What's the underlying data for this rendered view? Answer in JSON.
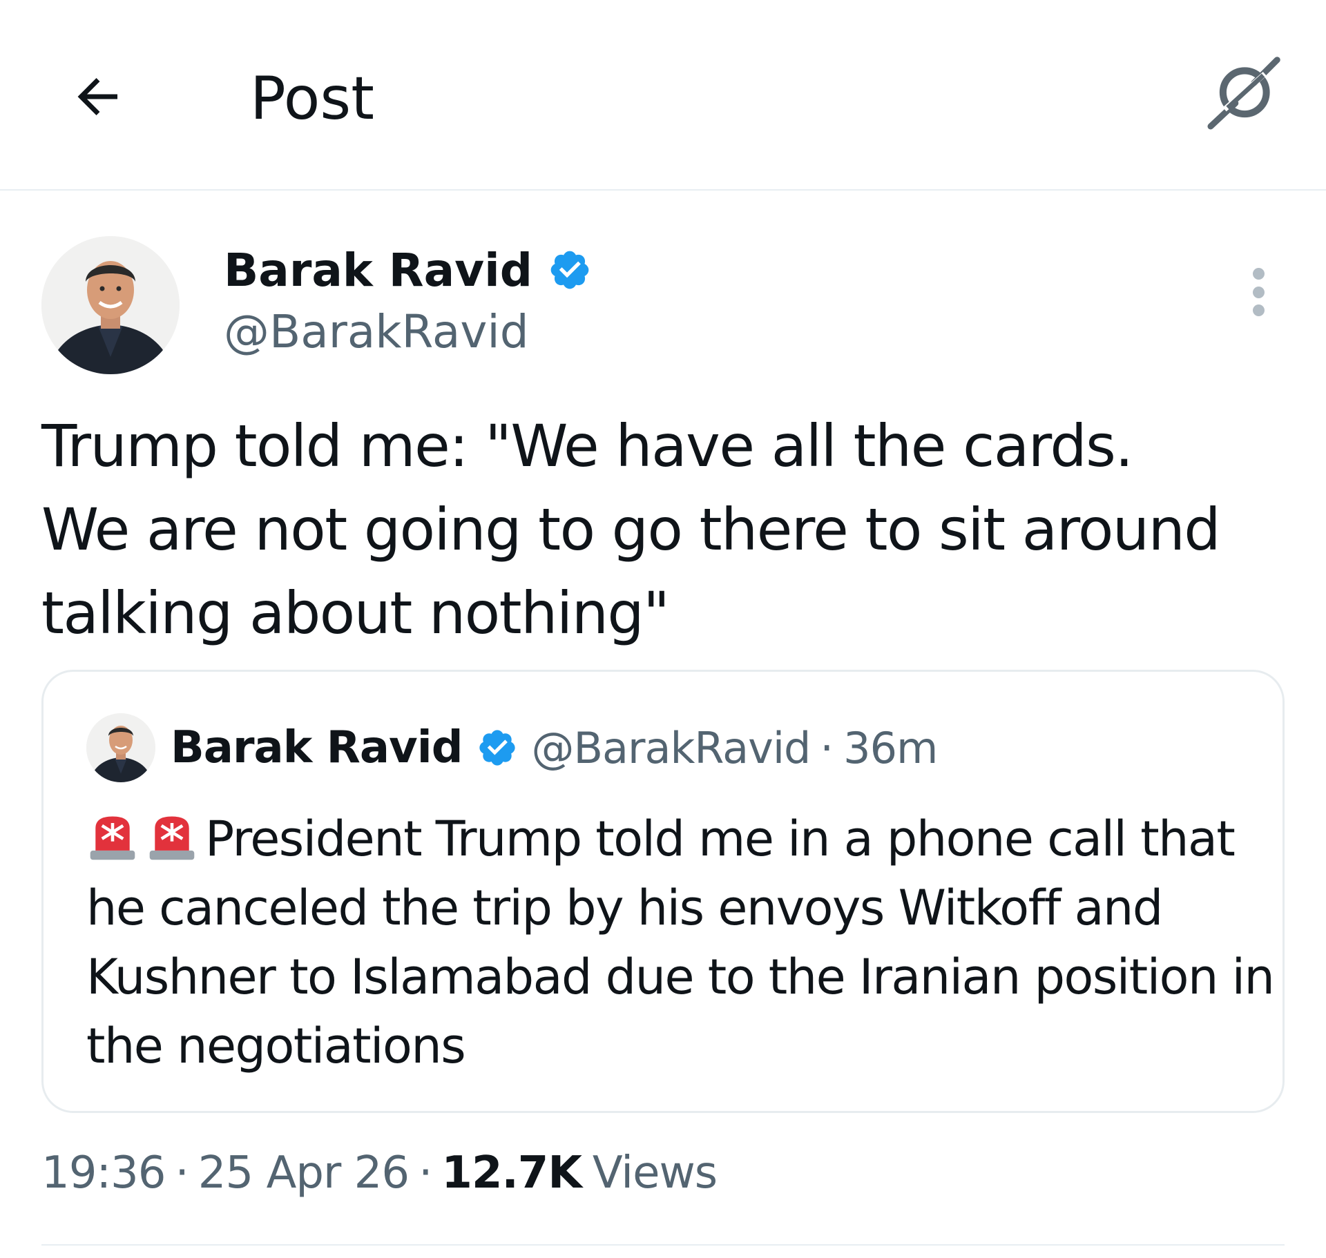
{
  "header": {
    "title": "Post",
    "back_icon": "arrow-left-icon",
    "grok_icon": "grok-icon"
  },
  "post": {
    "author": {
      "name": "Barak Ravid",
      "handle": "@BarakRavid",
      "verified": true
    },
    "text": "Trump told me: \"We have all the cards.\nWe are not going to go there to sit around\ntalking about nothing\"",
    "timestamp_time": "19:36",
    "timestamp_date": "25 Apr 26",
    "views_count": "12.7K",
    "views_label": "Views"
  },
  "quote": {
    "author": {
      "name": "Barak Ravid",
      "handle": "@BarakRavid",
      "verified": true
    },
    "separator": "·",
    "time_ago": "36m",
    "text": "President Trump told me in a phone call that he canceled the trip by his envoys Witkoff and Kushner to Islamabad due to the Iranian position in the negotiations",
    "emoji": [
      "police-light-icon",
      "police-light-icon"
    ]
  },
  "colors": {
    "text_primary": "#0f1419",
    "text_secondary": "#536471",
    "verified_blue": "#1d9bf0",
    "border": "#e7ecef"
  }
}
